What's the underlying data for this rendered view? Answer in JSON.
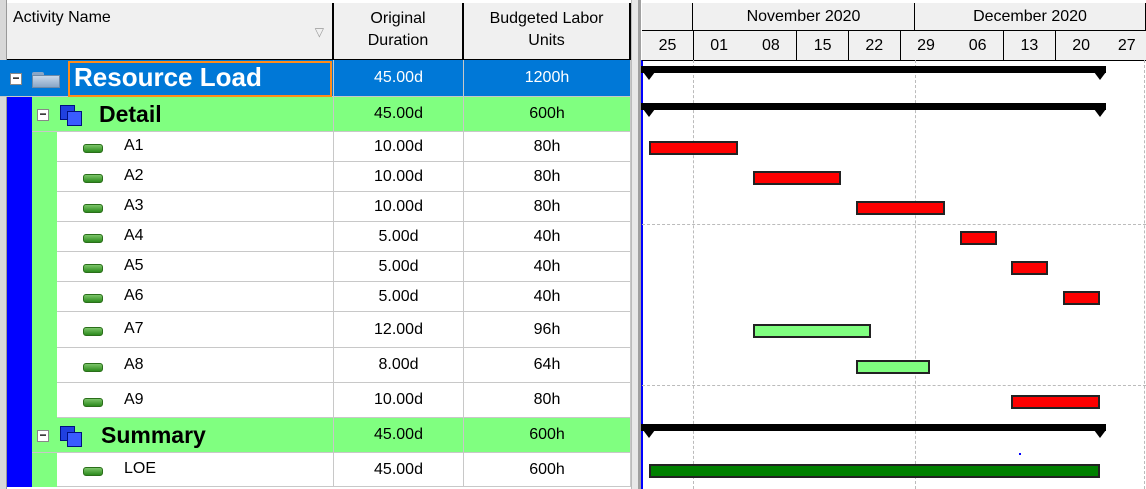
{
  "columns": {
    "name": "Activity Name",
    "duration": "Original Duration",
    "labor": "Budgeted Labor Units"
  },
  "timescale": {
    "months": [
      "November 2020",
      "December 2020"
    ],
    "weeks": [
      "25",
      "01",
      "08",
      "15",
      "22",
      "29",
      "06",
      "13",
      "20",
      "27"
    ],
    "origin": "2020-10-25"
  },
  "colors": {
    "selected": "#0078d7",
    "wbs_band": "#80ff80",
    "level_bar": "#0000ff",
    "critical": "#ff0000",
    "noncritical": "#80ff80",
    "loe": "#008000",
    "focus": "#ff8c1a"
  },
  "rows": [
    {
      "type": "project",
      "name": "Resource Load",
      "duration": "45.00d",
      "labor": "1200h",
      "icon": "folder-icon",
      "start": "2020-10-26",
      "finish": "2020-12-26"
    },
    {
      "type": "wbs",
      "name": "Detail",
      "duration": "45.00d",
      "labor": "600h",
      "icon": "wbs-icon",
      "start": "2020-10-26",
      "finish": "2020-12-26"
    },
    {
      "type": "task",
      "name": "A1",
      "duration": "10.00d",
      "labor": "80h",
      "bar": "critical",
      "start": "2020-10-26",
      "finish": "2020-11-07"
    },
    {
      "type": "task",
      "name": "A2",
      "duration": "10.00d",
      "labor": "80h",
      "bar": "critical",
      "start": "2020-11-09",
      "finish": "2020-11-21"
    },
    {
      "type": "task",
      "name": "A3",
      "duration": "10.00d",
      "labor": "80h",
      "bar": "critical",
      "start": "2020-11-23",
      "finish": "2020-12-05"
    },
    {
      "type": "task",
      "name": "A4",
      "duration": "5.00d",
      "labor": "40h",
      "bar": "critical",
      "start": "2020-12-07",
      "finish": "2020-12-12"
    },
    {
      "type": "task",
      "name": "A5",
      "duration": "5.00d",
      "labor": "40h",
      "bar": "critical",
      "start": "2020-12-14",
      "finish": "2020-12-19"
    },
    {
      "type": "task",
      "name": "A6",
      "duration": "5.00d",
      "labor": "40h",
      "bar": "critical",
      "start": "2020-12-21",
      "finish": "2020-12-26"
    },
    {
      "type": "task",
      "name": "A7",
      "duration": "12.00d",
      "labor": "96h",
      "bar": "noncritical",
      "start": "2020-11-09",
      "finish": "2020-11-25"
    },
    {
      "type": "task",
      "name": "A8",
      "duration": "8.00d",
      "labor": "64h",
      "bar": "noncritical",
      "start": "2020-11-23",
      "finish": "2020-12-03"
    },
    {
      "type": "task",
      "name": "A9",
      "duration": "10.00d",
      "labor": "80h",
      "bar": "critical",
      "start": "2020-12-14",
      "finish": "2020-12-26"
    },
    {
      "type": "wbs",
      "name": "Summary",
      "duration": "45.00d",
      "labor": "600h",
      "icon": "wbs-icon",
      "start": "2020-10-26",
      "finish": "2020-12-26"
    },
    {
      "type": "task",
      "name": "LOE",
      "duration": "45.00d",
      "labor": "600h",
      "bar": "loe",
      "start": "2020-10-26",
      "finish": "2020-12-26"
    }
  ]
}
